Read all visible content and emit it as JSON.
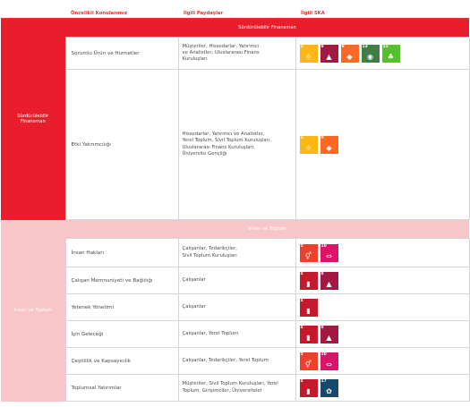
{
  "header": {
    "col1": "",
    "col2": "Öncelikli Konularımız",
    "col3": "İlgili Paydaşlar",
    "col4": "İlgili SKA"
  },
  "colors": {
    "primary_red": "#ea1d2c",
    "light_red": "#f8c6c9",
    "sdg1": "#fdb713",
    "sdg5": "#ef402b",
    "sdg8": "#a21942",
    "sdg9": "#fd6925",
    "sdg13": "#3f7e44",
    "sdg15": "#56c02b",
    "sdg10": "#dd1367",
    "sdg4": "#c5192d",
    "sdg17": "#19486a"
  },
  "sections": [
    {
      "group": "Sürdürülebilir\nFinansman",
      "banner": "Sürdürülebilir Finansman",
      "rows": [
        {
          "topic": "Sorumlu Ürün ve Hizmetler",
          "stakeholders": "Müşteriler, Hissedarlar, Yatırımcı\nve Analistler, Uluslararası Finans\nKuruluşları",
          "sdgs": [
            {
              "num": "1",
              "icon": "people-icon"
            },
            {
              "num": "8",
              "icon": "growth-chart-icon"
            },
            {
              "num": "9",
              "icon": "cubes-icon"
            },
            {
              "num": "13",
              "icon": "eye-icon"
            },
            {
              "num": "15",
              "icon": "tree-icon"
            }
          ]
        },
        {
          "topic": "Etki Yatırımcılığı",
          "stakeholders": "Hissedarlar, Yatırımcı ve Analistler,\nYerel Toplum, Sivil Toplum Kuruluşları,\nUluslararası Finans Kuruluşları,\nÜniversite Gençliği",
          "sdgs": [
            {
              "num": "1",
              "icon": "people-icon"
            },
            {
              "num": "9",
              "icon": "cubes-icon"
            }
          ]
        }
      ]
    },
    {
      "group": "İnsan ve Toplum",
      "banner": "İnsan ve Toplum",
      "rows": [
        {
          "topic": "İnsan Hakları",
          "stakeholders": "Çalışanlar, Tedarikçiler,\nSivil Toplum Kuruluşları",
          "sdgs": [
            {
              "num": "5",
              "icon": "gender-icon"
            },
            {
              "num": "10",
              "icon": "equality-icon"
            }
          ]
        },
        {
          "topic": "Çalışan Memnuniyeti ve Bağlılığı",
          "stakeholders": "Çalışanlar",
          "sdgs": [
            {
              "num": "4",
              "icon": "book-icon"
            },
            {
              "num": "8",
              "icon": "growth-chart-icon"
            }
          ]
        },
        {
          "topic": "Yetenek Yönetimi",
          "stakeholders": "Çalışanlar",
          "sdgs": [
            {
              "num": "4",
              "icon": "book-icon"
            }
          ]
        },
        {
          "topic": "İşin Geleceği",
          "stakeholders": "Çalışanlar, Yerel Toplum",
          "sdgs": [
            {
              "num": "4",
              "icon": "book-icon"
            },
            {
              "num": "8",
              "icon": "growth-chart-icon"
            }
          ]
        },
        {
          "topic": "Çeşitlilik ve Kapsayıcılık",
          "stakeholders": "Çalışanlar, Tedarikçiler, Yerel Toplum",
          "sdgs": [
            {
              "num": "5",
              "icon": "gender-icon"
            },
            {
              "num": "10",
              "icon": "equality-icon"
            }
          ]
        },
        {
          "topic": "Toplumsal Yatırımlar",
          "stakeholders": "Müşteriler, Sivil Toplum Kuruluşları, Yerel\nToplum, Girişimciler, Üniversiteler",
          "sdgs": [
            {
              "num": "4",
              "icon": "book-icon"
            },
            {
              "num": "17",
              "icon": "partnership-icon"
            }
          ]
        }
      ]
    }
  ]
}
